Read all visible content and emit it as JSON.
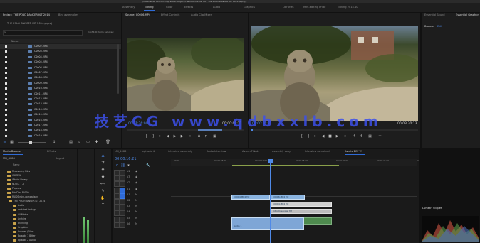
{
  "window_title": "/Volumes/MH-03 uncompressed project/The Polo Dancer Kit / The POLO DANCER KIT 2014.prproj *",
  "workspaces": [
    "Assembly",
    "Editing",
    "Color",
    "Effects",
    "Audio",
    "Graphics",
    "Libraries",
    "Mini-editing Pride",
    "Editing 2014.10"
  ],
  "active_workspace": "Editing",
  "project_panel": {
    "tabs": [
      "Project: THE POLO DANCER KIT 2014",
      "Bin: assemblies"
    ],
    "bin_path": "THE POLO DANCER KIT 2014.prproj",
    "search_placeholder": "",
    "items_count": "1 of 100 items selected",
    "column_header": "Name",
    "clips": [
      "C0002.MP4",
      "C0003.MP4",
      "C0004.MP4",
      "C0005.MP4",
      "C0006.MP4",
      "C0007.MP4",
      "C0008.MP4",
      "C0009.MP4",
      "C0010.MP4",
      "C0011.MP4",
      "C0012.MP4",
      "C0013.MP4",
      "C0014.MP4",
      "C0015.MP4",
      "C0016.MP4",
      "C0017.MP4",
      "C0018.MP4",
      "C0019.MP4"
    ]
  },
  "source_monitor": {
    "tabs": [
      "Source: C0006.MP4",
      "Effect Controls",
      "Audio Clip Mixer"
    ],
    "timecode_left": "00:21:36:00",
    "timecode_right": "00:00:09:21"
  },
  "program_monitor": {
    "timecode_left": "00:00:16:21",
    "timecode_right": "00:03:30:13"
  },
  "right_panel": {
    "tabs": [
      "Essential Sound",
      "Essential Graphics"
    ],
    "sub_tabs": [
      "Browse",
      "Edit"
    ]
  },
  "watermark": "技艺CG www.qdbxxlb.com",
  "media_browser": {
    "tabs": [
      "Media Browser",
      "Effects"
    ],
    "path": "MH_4088",
    "ingest_label": "Ingest",
    "column_header": "Name",
    "folders": [
      "Recovering Files",
      "CAMERA",
      "iPhoto Library",
      "NO_EX T 2",
      "Projects",
      "MiniDisc P0009",
      "RAIDS mini-comparison",
      "THE POLO DANCER KIT 2014",
      "Audio",
      "archived footage",
      "All Media",
      "Archive",
      "Branding",
      "Graphics",
      "Sources (Files)",
      "Episode 1 Bitter",
      "Episode 2 Audio"
    ]
  },
  "timeline": {
    "tabs": [
      "MH_4088",
      "episode 4",
      "interview assembly",
      "Audio Interview",
      "Assem FINAL",
      "assembly copy",
      "Interview combined",
      "Ascots DEF V1"
    ],
    "active_tab": "Ascots DEF V1",
    "timecode": "00:00:16:21",
    "ruler": [
      "00:00",
      "00:00:05:00",
      "00:00:10:00",
      "00:00:15:00",
      "00:00:20:00",
      "00:00:25:00",
      "00:00:30:00"
    ],
    "video_tracks": [
      "V4",
      "V3",
      "V2",
      "V1"
    ],
    "audio_tracks": [
      "A1",
      "A2",
      "A3",
      "A4",
      "A5",
      "A6"
    ],
    "mixer_labels": [
      "Master",
      "Audio 1"
    ],
    "track_names": [
      "MH_4",
      "MH_3",
      "MH_2",
      "MH_1",
      "MH_0",
      "MH_5",
      "MH_6",
      "MH_7",
      "MH_8",
      "MH_9",
      "MH_10",
      "MH_11"
    ],
    "clips": {
      "v1_a": "C0004.MP4 [V]",
      "v1_b": "C0006.MP4 [V]",
      "v1_c": "C0004.MP4 [V]",
      "v1_d": "Intro Interview [V]",
      "a1": "Audio Interview 07",
      "a2": "Audio 1"
    }
  },
  "scopes": {
    "tab": "Lumetri Scopes"
  }
}
